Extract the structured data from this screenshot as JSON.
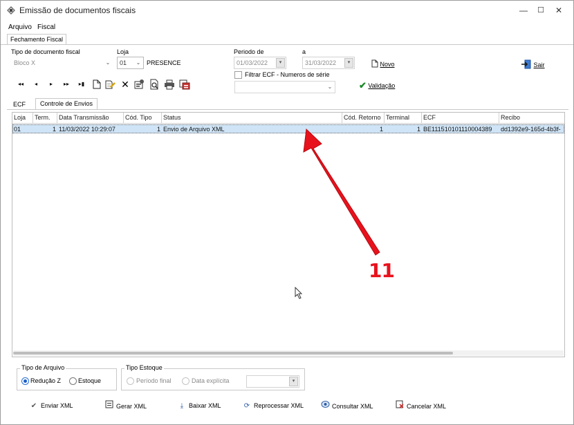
{
  "window": {
    "title": "Emissão de documentos fiscais",
    "minimize": "—",
    "maximize": "☐",
    "close": "✕"
  },
  "menu": {
    "items": [
      "Arquivo",
      "Fiscal"
    ]
  },
  "main_tab": "Fechamento Fiscal",
  "filters": {
    "doc_type_label": "Tipo de documento fiscal",
    "doc_type_value": "Bloco X",
    "loja_label": "Loja",
    "loja_value": "01",
    "loja_name": "PRESENCE",
    "periodo_label": "Periodo  de",
    "periodo_a_label": "a",
    "periodo_de_value": "01/03/2022",
    "periodo_ate_value": "31/03/2022",
    "filtrar_label": "Filtrar ECF - Numeros de  série",
    "filtrar_value": ""
  },
  "actions": {
    "novo": "Novo",
    "validacao": "Validação",
    "sair": "Sair"
  },
  "nav_buttons": [
    "◂◂",
    "◂",
    "▸",
    "▸▸",
    "▸▮"
  ],
  "inner_tabs": [
    "ECF",
    "Controle de Envios"
  ],
  "grid": {
    "columns": [
      "Loja",
      "Term.",
      "Data Transmissão",
      "Cód. Tipo",
      "Status",
      "Cód. Retorno",
      "Terminal",
      "ECF",
      "Recibo"
    ],
    "rows": [
      [
        "01",
        "1",
        "11/03/2022 10:29:07",
        "1",
        "Envio de Arquivo XML",
        "1",
        "1",
        "BE111510101110004389",
        "dd1392e9-165d-4b3f-"
      ]
    ]
  },
  "tipo_arquivo": {
    "title": "Tipo de Arquivo",
    "option1": "Redução Z",
    "option2": "Estoque",
    "selected": "Redução Z"
  },
  "tipo_estoque": {
    "title": "Tipo Estoque",
    "option1": "Período final",
    "option2": "Data explícita",
    "date_value": ""
  },
  "bottom_buttons": {
    "enviar": "Enviar XML",
    "gerar": "Gerar XML",
    "baixar": "Baixar XML",
    "reprocessar": "Reprocessar XML",
    "consultar": "Consultar XML",
    "cancelar": "Cancelar XML"
  },
  "annotation": {
    "number": "11",
    "color": "#e8121c"
  },
  "colors": {
    "selection": "#cfe4f6",
    "accent": "#1d5fc8",
    "annotation": "#e8121c"
  }
}
